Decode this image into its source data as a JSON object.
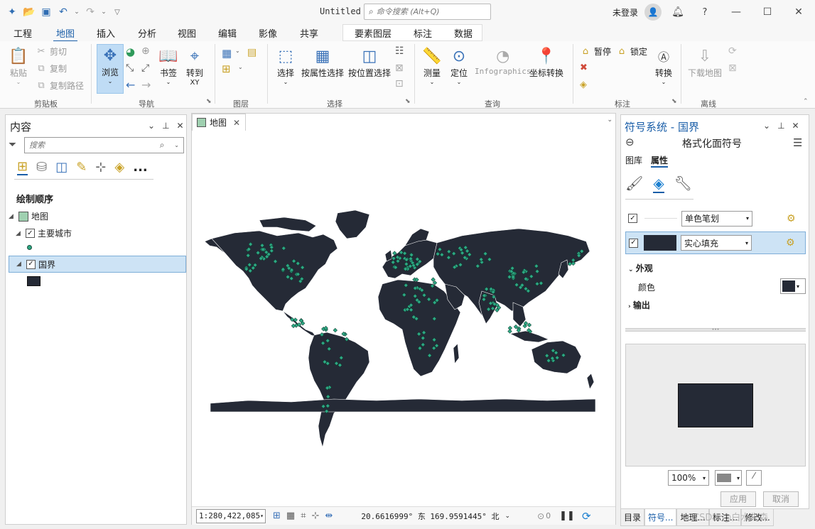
{
  "titlebar": {
    "doc_title": "Untitled",
    "search_placeholder": "命令搜索 (Alt+Q)",
    "login_label": "未登录",
    "help_label": "?"
  },
  "menu": {
    "tabs": [
      "工程",
      "地图",
      "插入",
      "分析",
      "视图",
      "编辑",
      "影像",
      "共享"
    ],
    "active_tab": "地图",
    "context_tabs": [
      "要素图层",
      "标注",
      "数据"
    ]
  },
  "ribbon": {
    "clipboard": {
      "paste": "粘贴",
      "cut": "剪切",
      "copy": "复制",
      "copy_path": "复制路径",
      "label": "剪贴板"
    },
    "navigate": {
      "explore": "浏览",
      "bookmarks": "书签",
      "goto": "转到",
      "goto_sub": "XY",
      "label": "导航"
    },
    "layer": {
      "label": "图层"
    },
    "selection": {
      "select": "选择",
      "by_attr": "按属性选择",
      "by_loc": "按位置选择",
      "label": "选择"
    },
    "inquiry": {
      "measure": "测量",
      "locate": "定位",
      "infographics": "Infographics",
      "convert_coords": "坐标转换",
      "label": "查询"
    },
    "labeling": {
      "pause": "暂停",
      "lock": "锁定",
      "convert": "转换",
      "label": "标注"
    },
    "offline": {
      "download": "下载地图",
      "label": "离线"
    }
  },
  "contents": {
    "title": "内容",
    "search_placeholder": "搜索",
    "draw_order": "绘制顺序",
    "map_label": "地图",
    "layers": [
      {
        "name": "主要城市",
        "checked": true
      },
      {
        "name": "国界",
        "checked": true,
        "selected": true
      }
    ],
    "more": "..."
  },
  "map_tab": {
    "label": "地图"
  },
  "status": {
    "scale": "1:280,422,085",
    "coords": "20.6616999° 东 169.9591445° 北",
    "selection_count": "0"
  },
  "symbology": {
    "title": "符号系统 - 国界",
    "subtitle": "格式化面符号",
    "tabs": [
      "图库",
      "属性"
    ],
    "active_tab": "属性",
    "stroke_type": "单色笔划",
    "fill_type": "实心填充",
    "appearance": "外观",
    "color_label": "颜色",
    "output": "输出",
    "zoom": "100%",
    "apply": "应用",
    "cancel": "取消",
    "fill_color": "#252a36"
  },
  "bottom_tabs": [
    "目录",
    "符号...",
    "地理...",
    "标注...",
    "修改..."
  ],
  "watermark": "CSDN @白水先森",
  "colors": {
    "land": "#252a36",
    "city": "#2da883",
    "accent": "#1a5ea8",
    "selection": "#cde3f5"
  }
}
